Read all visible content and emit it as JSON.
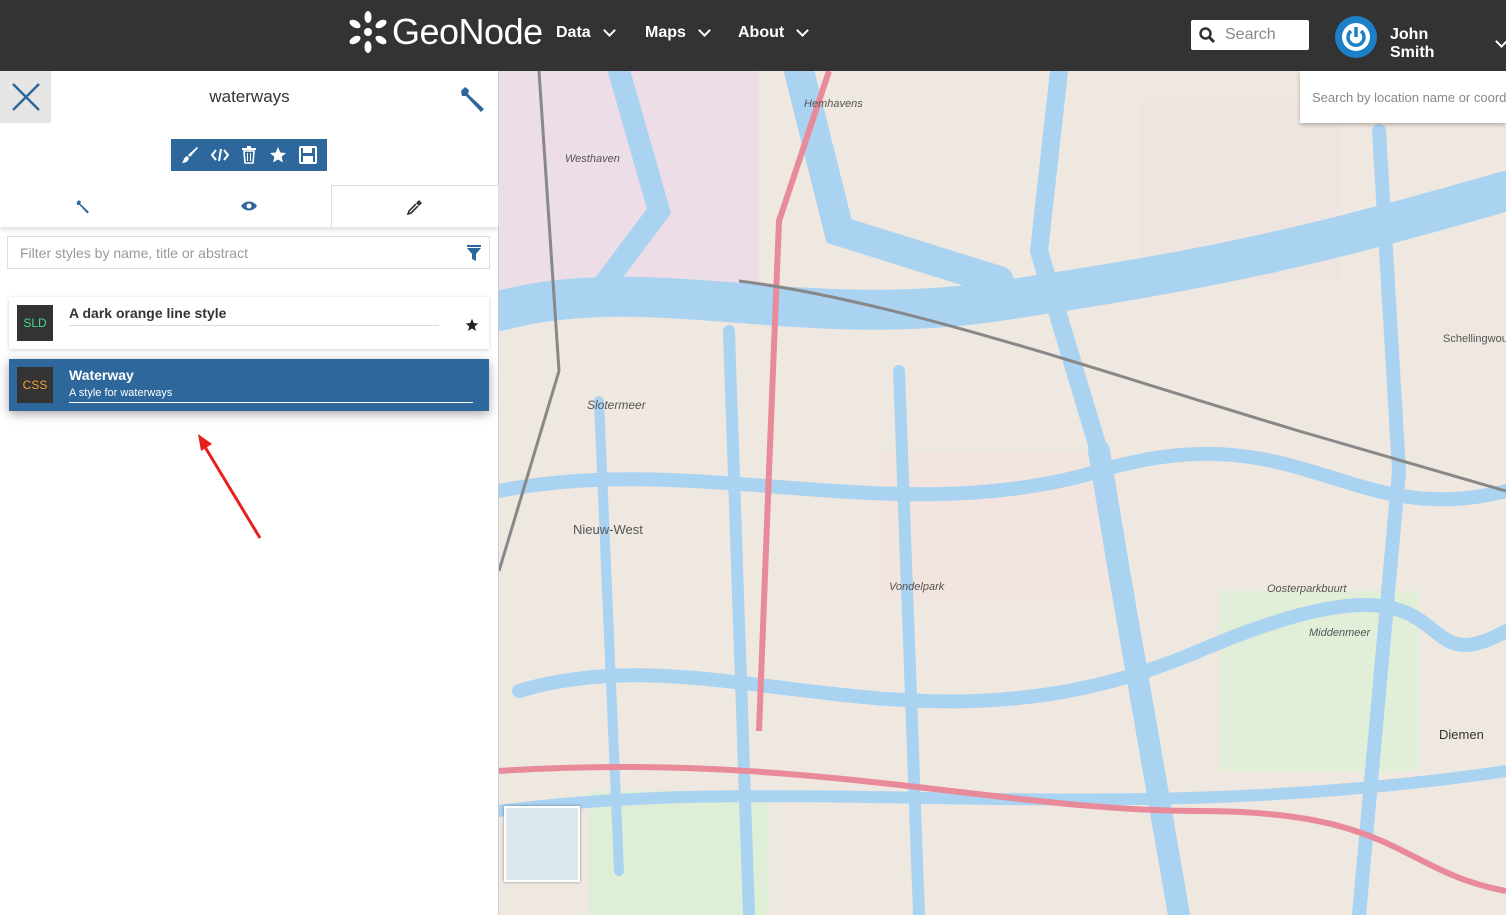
{
  "header": {
    "brand": "GeoNode",
    "nav": [
      {
        "label": "Data"
      },
      {
        "label": "Maps"
      },
      {
        "label": "About"
      }
    ],
    "search_placeholder": "Search",
    "user": "John Smith"
  },
  "panel": {
    "title": "waterways",
    "toolbar_icons": [
      "brush-icon",
      "code-icon",
      "trash-icon",
      "star-icon",
      "save-icon"
    ],
    "tabs": [
      {
        "icon": "wrench-icon"
      },
      {
        "icon": "eye-icon"
      },
      {
        "icon": "eyedropper-icon",
        "active": true
      }
    ],
    "filter_placeholder": "Filter styles by name, title or abstract",
    "styles": [
      {
        "format": "SLD",
        "format_color": "#3fdc8a",
        "title": "A dark orange line style",
        "abstract": "",
        "default": true,
        "selected": false
      },
      {
        "format": "CSS",
        "format_color": "#f2a33a",
        "title": "Waterway",
        "abstract": "A style for waterways",
        "default": false,
        "selected": true
      }
    ]
  },
  "map": {
    "search_placeholder": "Search by location name or coordinates",
    "labels": [
      "Westhaven",
      "Hemhavens",
      "Slotermeer",
      "Nieuw-West",
      "Vondelpark",
      "Diemen",
      "Schellingwoude",
      "Oosterparkbuurt",
      "Middenmeer"
    ]
  },
  "colors": {
    "accent": "#2d679b",
    "topbar": "#333333",
    "water": "#aad3f2",
    "annotation_arrow": "#e8201c"
  }
}
